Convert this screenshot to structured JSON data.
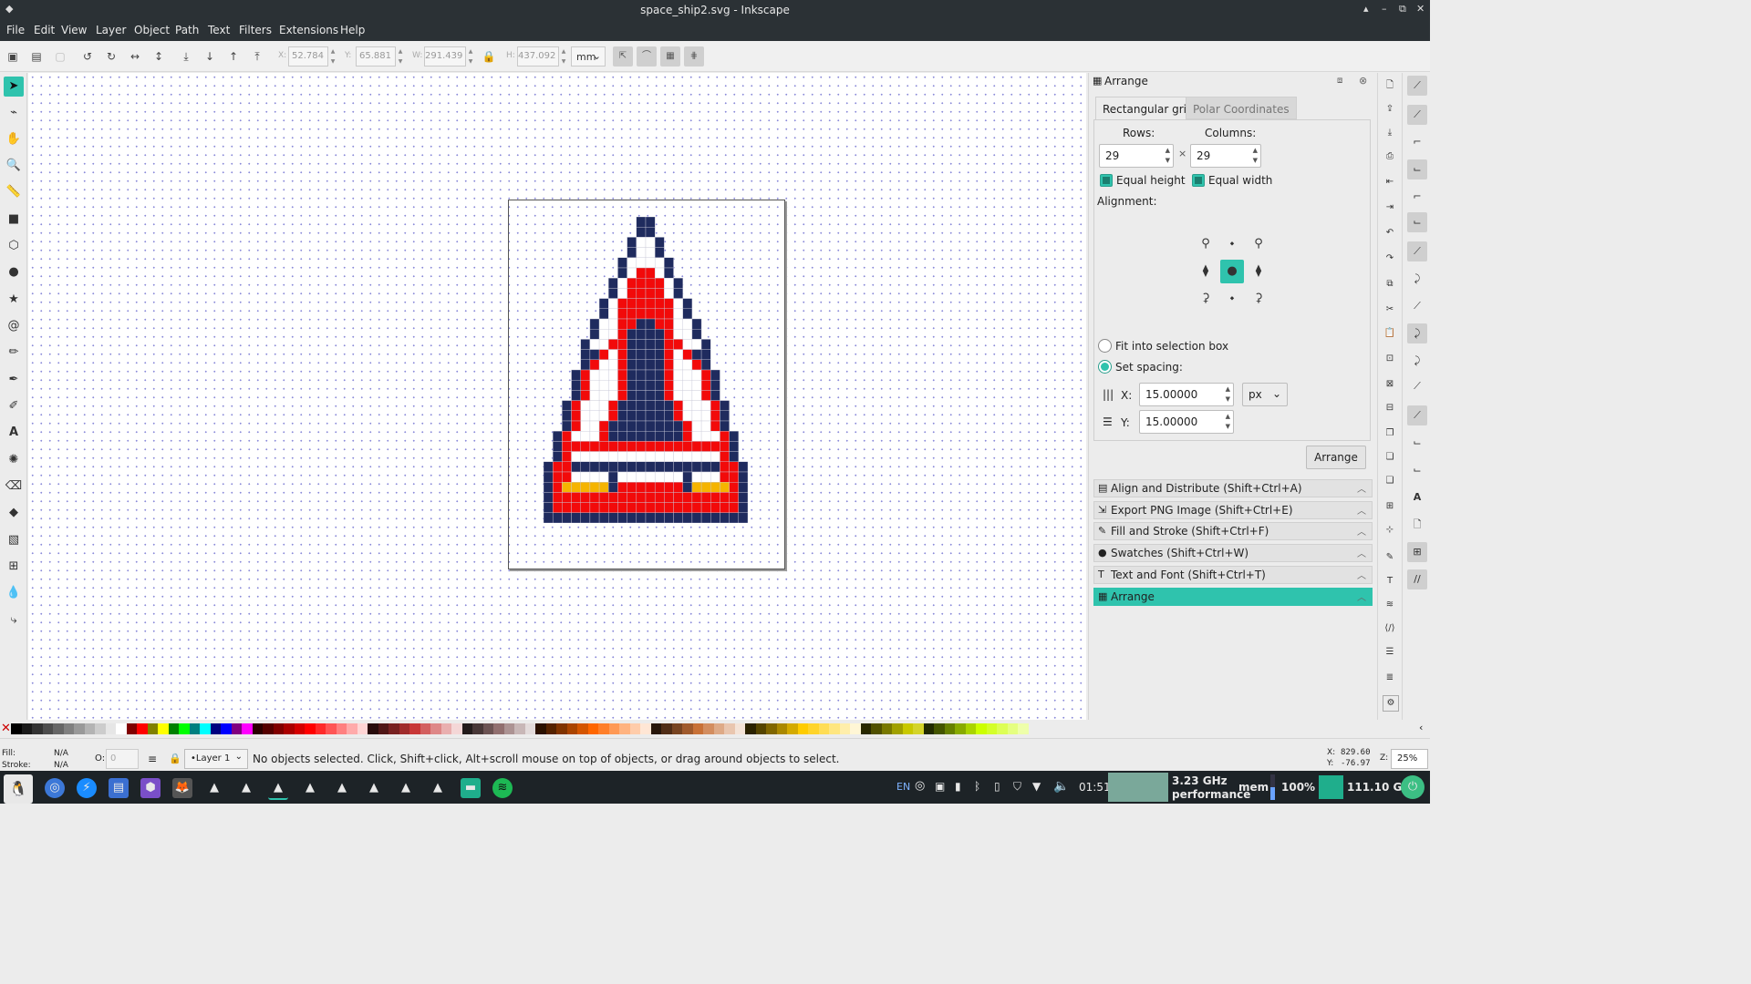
{
  "window": {
    "title": "space_ship2.svg - Inkscape",
    "controls": [
      "▴",
      "–",
      "⧉",
      "✕"
    ]
  },
  "menu": [
    "File",
    "Edit",
    "View",
    "Layer",
    "Object",
    "Path",
    "Text",
    "Filters",
    "Extensions",
    "Help"
  ],
  "toolbar": {
    "x_label": "X:",
    "x_value": "52.784",
    "y_label": "Y:",
    "y_value": "65.881",
    "w_label": "W:",
    "w_value": "291.439",
    "h_label": "H:",
    "h_value": "437.092",
    "unit": "mm"
  },
  "toolbox": {
    "tools": [
      "selector-tool",
      "node-tool",
      "tweak-tool",
      "zoom-tool",
      "measure-tool",
      "rect-tool",
      "box3d-tool",
      "ellipse-tool",
      "star-tool",
      "spiral-tool",
      "pencil-tool",
      "pen-tool",
      "calligraphy-tool",
      "text-tool",
      "spray-tool",
      "eraser-tool",
      "bucket-tool",
      "gradient-tool",
      "mesh-tool",
      "dropper-tool",
      "connector-tool"
    ],
    "active": "selector-tool"
  },
  "drawing": {
    "colors": {
      "navy": "#1f2b5e",
      "red": "#f20a0a",
      "white": "#ffffff",
      "gold": "#f5b400"
    },
    "grid_size": [
      22,
      34
    ],
    "rows": [
      "..........NN..........",
      "..........NN..........",
      ".........NWWN.........",
      ".........NWWN.........",
      "........NWWWWN........",
      "........NWRRWN........",
      ".......NWRRRRWN.......",
      ".......NWRRRRWN.......",
      "......NWRRRRRRWN......",
      "......NWRRRRRRWN......",
      ".....NWWRRNNRRWWN.....",
      ".....NWWRNNNNRWWN.....",
      "....NWWRRNNNNRRWWN....",
      "....NNRWRNNNNRWRNN....",
      "....NRWWRNNNNRWWRN....",
      "...NRWWWRNNNNRWWWRN...",
      "...NRWWWRNNNNRWWWRN...",
      "...NRWWWRNNNNRWWWRN...",
      "..NRWWWRNNNNNNRWWWRN..",
      "..NRWWWRNNNNNNRWWWRN..",
      "..NRWWRNNNNNNNNRWWRN..",
      ".NRWWWRNNNNNNNNRWWWRN.",
      ".NRRRRRRRRRRRRRRRRRRN.",
      ".NRWWWWWWWWWWWWWWWWRN.",
      "NRRNNNNNNNNNNNNNNNNRRN",
      "NRRWWWWNWWWWWWWNWWWRRN",
      "NRGGGGGNRRRRRRRNGGGGRN",
      "NRRRRRRRRRRRRRRRRRRRRN",
      "NRRRRRRRRRRRRRRRRRRRRN",
      "NNNNNNNNNNNNNNNNNNNNNN"
    ]
  },
  "arrange": {
    "panel_title": "Arrange",
    "tabs": [
      "Rectangular grid",
      "Polar Coordinates"
    ],
    "rows_label": "Rows:",
    "columns_label": "Columns:",
    "rows_value": "29",
    "columns_value": "29",
    "times": "×",
    "equal_height": "Equal height",
    "equal_width": "Equal width",
    "alignment_label": "Alignment:",
    "fit_label": "Fit into selection box",
    "spacing_label": "Set spacing:",
    "x_label": "X:",
    "y_label": "Y:",
    "x_spacing": "15.00000",
    "y_spacing": "15.00000",
    "spacing_unit": "px",
    "arrange_button": "Arrange"
  },
  "docked_dialogs": [
    {
      "label": "Align and Distribute (Shift+Ctrl+A)",
      "icon": "▤"
    },
    {
      "label": "Export PNG Image (Shift+Ctrl+E)",
      "icon": "⇲"
    },
    {
      "label": "Fill and Stroke (Shift+Ctrl+F)",
      "icon": "✎"
    },
    {
      "label": "Swatches (Shift+Ctrl+W)",
      "icon": "●"
    },
    {
      "label": "Text and Font (Shift+Ctrl+T)",
      "icon": "T"
    },
    {
      "label": "Arrange",
      "icon": "▦"
    }
  ],
  "status": {
    "fill_label": "Fill:",
    "fill_value": "N/A",
    "stroke_label": "Stroke:",
    "stroke_value": "N/A",
    "opacity_label": "O:",
    "opacity_value": "0",
    "layer": "•Layer 1",
    "message": "No objects selected. Click, Shift+click, Alt+scroll mouse on top of objects, or drag around objects to select.",
    "cursor_x_label": "X:",
    "cursor_x": "829.60",
    "cursor_y_label": "Y:",
    "cursor_y": "-76.97",
    "zoom_label": "Z:",
    "zoom": "25%"
  },
  "taskbar": {
    "lang": "EN",
    "time": "01:51",
    "cpu_freq": "3.23 GHz",
    "cpu_mode": "performance",
    "mem_label": "mem",
    "battery": "100%",
    "disk": "111.10 GB"
  }
}
